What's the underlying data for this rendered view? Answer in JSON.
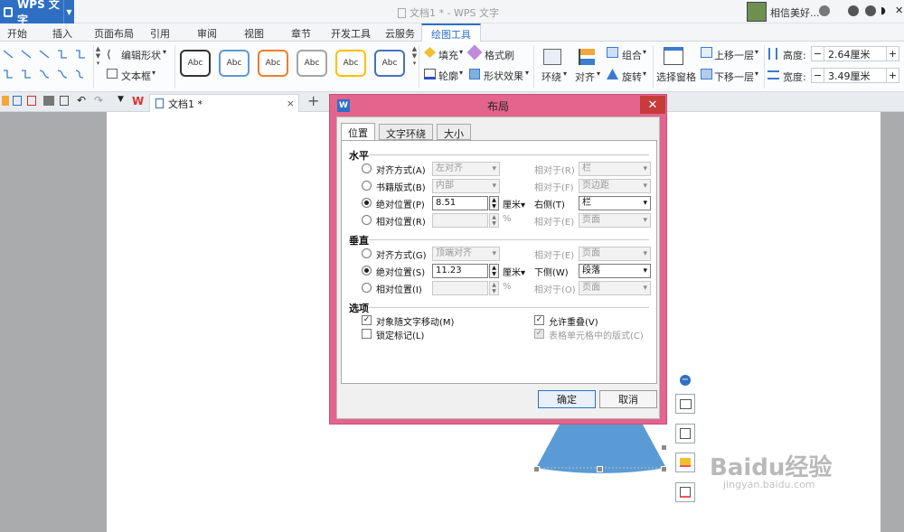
{
  "window": {
    "app_label": "WPS 文字",
    "title": "文档1 * - WPS 文字",
    "user": "相信美好..."
  },
  "menu": {
    "tabs": [
      "开始",
      "插入",
      "页面布局",
      "引用",
      "审阅",
      "视图",
      "章节",
      "开发工具",
      "云服务",
      "绘图工具"
    ],
    "active": "绘图工具"
  },
  "ribbon": {
    "edit_shape": "编辑形状",
    "textbox": "文本框",
    "styles": [
      "Abc",
      "Abc",
      "Abc",
      "Abc",
      "Abc",
      "Abc"
    ],
    "style_colors": [
      "#333333",
      "#5b9bd5",
      "#ed7d31",
      "#a5a5a5",
      "#ffc000",
      "#4472c4"
    ],
    "fill": "填充",
    "format_brush": "格式刷",
    "outline": "轮廓",
    "shape_effect": "形状效果",
    "wrap": "环绕",
    "align": "对齐",
    "group": "组合",
    "rotate": "旋转",
    "select_pane": "选择窗格",
    "bring_forward": "上移一层",
    "send_backward": "下移一层",
    "height_label": "高度:",
    "height_value": "2.64厘米",
    "width_label": "宽度:",
    "width_value": "3.49厘米"
  },
  "doc_tab": {
    "name": "文档1 *"
  },
  "dialog": {
    "title": "布局",
    "tabs": [
      "位置",
      "文字环绕",
      "大小"
    ],
    "horizontal": {
      "heading": "水平",
      "align_label": "对齐方式(A)",
      "align_value": "左对齐",
      "align_rel_label": "相对于(R)",
      "align_rel_value": "栏",
      "book_label": "书籍版式(B)",
      "book_value": "内部",
      "book_rel_label": "相对于(F)",
      "book_rel_value": "页边距",
      "abs_label": "绝对位置(P)",
      "abs_value": "8.51",
      "abs_unit": "厘米",
      "abs_rel_label": "右侧(T)",
      "abs_rel_value": "栏",
      "rel_label": "相对位置(R)",
      "rel_unit": "%",
      "rel_rel_label": "相对于(E)",
      "rel_rel_value": "页面"
    },
    "vertical": {
      "heading": "垂直",
      "align_label": "对齐方式(G)",
      "align_value": "顶端对齐",
      "align_rel_label": "相对于(E)",
      "align_rel_value": "页面",
      "abs_label": "绝对位置(S)",
      "abs_value": "11.23",
      "abs_unit": "厘米",
      "abs_rel_label": "下侧(W)",
      "abs_rel_value": "段落",
      "rel_label": "相对位置(I)",
      "rel_unit": "%",
      "rel_rel_label": "相对于(O)",
      "rel_rel_value": "页面"
    },
    "options": {
      "heading": "选项",
      "move_with_text": "对象随文字移动(M)",
      "lock_anchor": "锁定标记(L)",
      "allow_overlap": "允许重叠(V)",
      "table_layout": "表格单元格中的版式(C)"
    },
    "ok": "确定",
    "cancel": "取消"
  },
  "watermark": {
    "brand": "Baidu经验",
    "url": "jingyan.baidu.com"
  }
}
